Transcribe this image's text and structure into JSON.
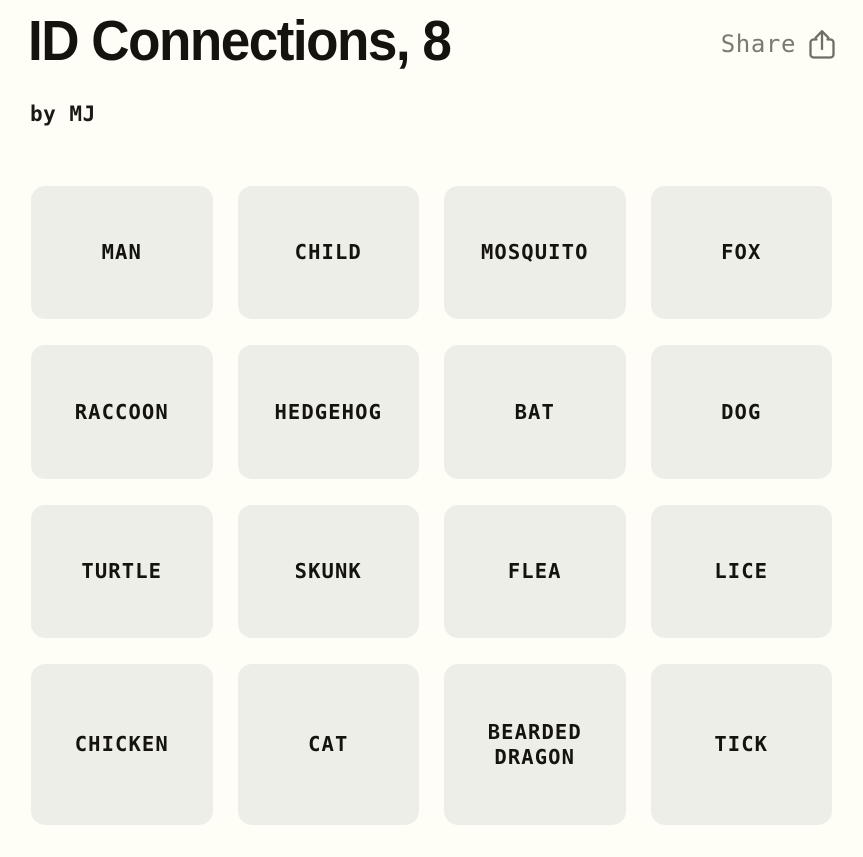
{
  "header": {
    "title": "ID Connections, 8",
    "byline": "by MJ",
    "share_label": "Share",
    "share_icon": "share-icon"
  },
  "colors": {
    "background": "#FEFDF6",
    "tile_background": "#EEEEE8",
    "text": "#15130E",
    "muted_text": "#7C7A70"
  },
  "grid": {
    "columns": 4,
    "rows": 4,
    "tiles": [
      {
        "label": "MAN"
      },
      {
        "label": "CHILD"
      },
      {
        "label": "MOSQUITO"
      },
      {
        "label": "FOX"
      },
      {
        "label": "RACCOON"
      },
      {
        "label": "HEDGEHOG"
      },
      {
        "label": "BAT"
      },
      {
        "label": "DOG"
      },
      {
        "label": "TURTLE"
      },
      {
        "label": "SKUNK"
      },
      {
        "label": "FLEA"
      },
      {
        "label": "LICE"
      },
      {
        "label": "CHICKEN"
      },
      {
        "label": "CAT"
      },
      {
        "label": "BEARDED\nDRAGON"
      },
      {
        "label": "TICK"
      }
    ]
  }
}
